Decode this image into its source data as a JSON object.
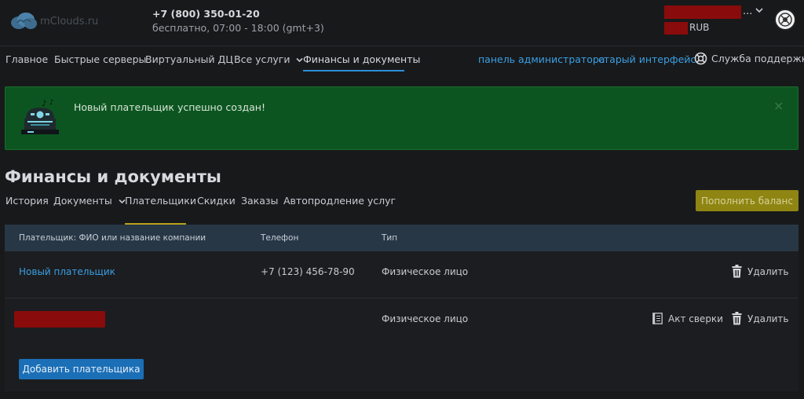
{
  "header": {
    "logo_text": "mClouds.ru",
    "phone": "+7 (800) 350-01-20",
    "hours": "бесплатно, 07:00 - 18:00 (gmt+3)",
    "account_dots": "...",
    "currency": "RUB",
    "icons": [
      "cloud-logo-icon",
      "chevron-down-icon",
      "avatar"
    ]
  },
  "nav": {
    "items": [
      {
        "label": "Главное"
      },
      {
        "label": "Быстрые серверы"
      },
      {
        "label": "Виртуальный ДЦ"
      },
      {
        "label": "Все услуги"
      },
      {
        "label": "Финансы и документы"
      }
    ],
    "admin_link": "панель администратора",
    "old_ui_link": "старый интерфейс",
    "support": "Служба поддержки"
  },
  "alert": {
    "message": "Новый плательщик успешно создан!",
    "close": "×",
    "colors": {
      "background": "#0d5520"
    }
  },
  "page": {
    "title": "Финансы и документы",
    "tabs": [
      "История",
      "Документы",
      "Плательщики",
      "Скидки",
      "Заказы",
      "Автопродление услуг"
    ],
    "active_tab": "Плательщики",
    "topup_button": "Пополнить баланс"
  },
  "table": {
    "columns": [
      "Плательщик: ФИО или название компании",
      "Телефон",
      "Тип"
    ],
    "rows": [
      {
        "name": "Новый плательщик",
        "phone": "+7 (123) 456-78-90",
        "type": "Физическое лицо",
        "delete": "Удалить"
      },
      {
        "type": "Физическое лицо",
        "act": "Акт сверки",
        "delete": "Удалить"
      }
    ],
    "add_button": "Добавить плательщика"
  },
  "colors": {
    "accent_link": "#3aa0e3",
    "active_nav_underline": "#2c8fd6",
    "tab_underline": "#b9a21b",
    "topup_button": "#8f8512",
    "add_button": "#1b6fb6",
    "redaction": "#8a0b0b"
  }
}
